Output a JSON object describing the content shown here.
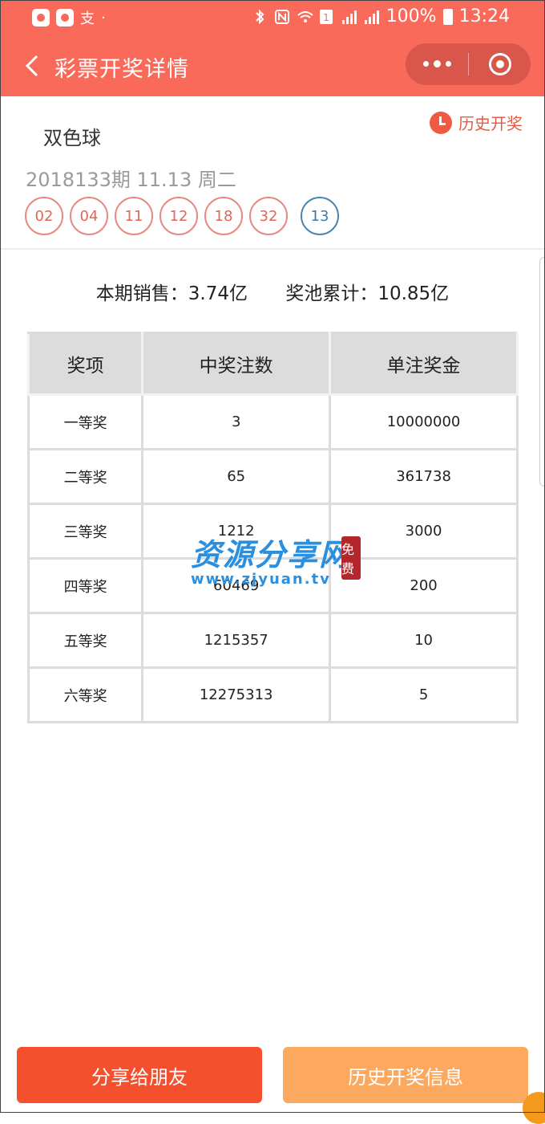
{
  "status_bar": {
    "battery": "100%",
    "time": "13:24",
    "alipay_glyph": "支"
  },
  "nav": {
    "title": "彩票开奖详情"
  },
  "lottery": {
    "name": "双色球",
    "history_link": "历史开奖",
    "issue": "2018133期 11.13 周二",
    "red_balls": [
      "02",
      "04",
      "11",
      "12",
      "18",
      "32"
    ],
    "blue_ball": "13"
  },
  "summary": {
    "sales": "本期销售：3.74亿",
    "pool": "奖池累计：10.85亿"
  },
  "table": {
    "headers": [
      "奖项",
      "中奖注数",
      "单注奖金"
    ],
    "rows": [
      [
        "一等奖",
        "3",
        "10000000"
      ],
      [
        "二等奖",
        "65",
        "361738"
      ],
      [
        "三等奖",
        "1212",
        "3000"
      ],
      [
        "四等奖",
        "60469",
        "200"
      ],
      [
        "五等奖",
        "1215357",
        "10"
      ],
      [
        "六等奖",
        "12275313",
        "5"
      ]
    ]
  },
  "watermark": {
    "title": "资源分享网",
    "url": "www.zjyuan.tv",
    "seal": "免费"
  },
  "buttons": {
    "share": "分享给朋友",
    "history": "历史开奖信息"
  },
  "colors": {
    "header": "#f96a5b",
    "share_button": "#f5502d",
    "history_button": "#fca95f",
    "blue_ball": "#4a86b0",
    "red_ball": "#e68a80"
  }
}
